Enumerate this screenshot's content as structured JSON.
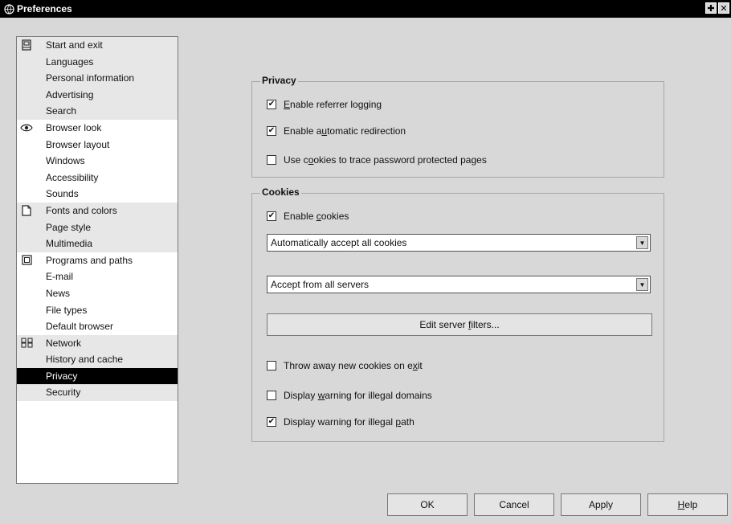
{
  "window": {
    "title": "Preferences",
    "icon": "globe-icon"
  },
  "titlebar_buttons": {
    "maximize": "✚",
    "close": "✕"
  },
  "sidebar": {
    "groups": [
      {
        "icon": "door-icon",
        "shaded": true,
        "items": [
          "Start and exit",
          "Languages",
          "Personal information",
          "Advertising",
          "Search"
        ]
      },
      {
        "icon": "eye-icon",
        "shaded": false,
        "items": [
          "Browser look",
          "Browser layout",
          "Windows",
          "Accessibility",
          "Sounds"
        ]
      },
      {
        "icon": "document-icon",
        "shaded": true,
        "items": [
          "Fonts and colors",
          "Page style",
          "Multimedia"
        ]
      },
      {
        "icon": "program-icon",
        "shaded": false,
        "items": [
          "Programs and paths",
          "E-mail",
          "News",
          "File types",
          "Default browser"
        ]
      },
      {
        "icon": "network-icon",
        "shaded": true,
        "items": [
          "Network",
          "History and cache",
          "Privacy",
          "Security"
        ]
      }
    ],
    "selected": "Privacy"
  },
  "privacy": {
    "legend": "Privacy",
    "options": [
      {
        "pre": "",
        "key": "E",
        "post": "nable referrer logging",
        "checked": true
      },
      {
        "pre": "Enable a",
        "key": "u",
        "post": "tomatic redirection",
        "checked": true
      },
      {
        "pre": "Use c",
        "key": "o",
        "post": "okies to trace password protected pages",
        "checked": false
      }
    ]
  },
  "cookies": {
    "legend": "Cookies",
    "enable": {
      "pre": "Enable ",
      "key": "c",
      "post": "ookies",
      "checked": true
    },
    "accept_policy": "Automatically accept all cookies",
    "server_policy": "Accept from all servers",
    "edit_filters": {
      "pre": "Edit server ",
      "key": "f",
      "post": "ilters..."
    },
    "options": [
      {
        "pre": "Throw away new cookies on e",
        "key": "x",
        "post": "it",
        "checked": false
      },
      {
        "pre": "Display ",
        "key": "w",
        "post": "arning for illegal domains",
        "checked": false
      },
      {
        "pre": "Display warning for illegal ",
        "key": "p",
        "post": "ath",
        "checked": true
      }
    ]
  },
  "footer": {
    "ok": "OK",
    "cancel": "Cancel",
    "apply": "Apply",
    "help": {
      "pre": "",
      "key": "H",
      "post": "elp"
    }
  }
}
